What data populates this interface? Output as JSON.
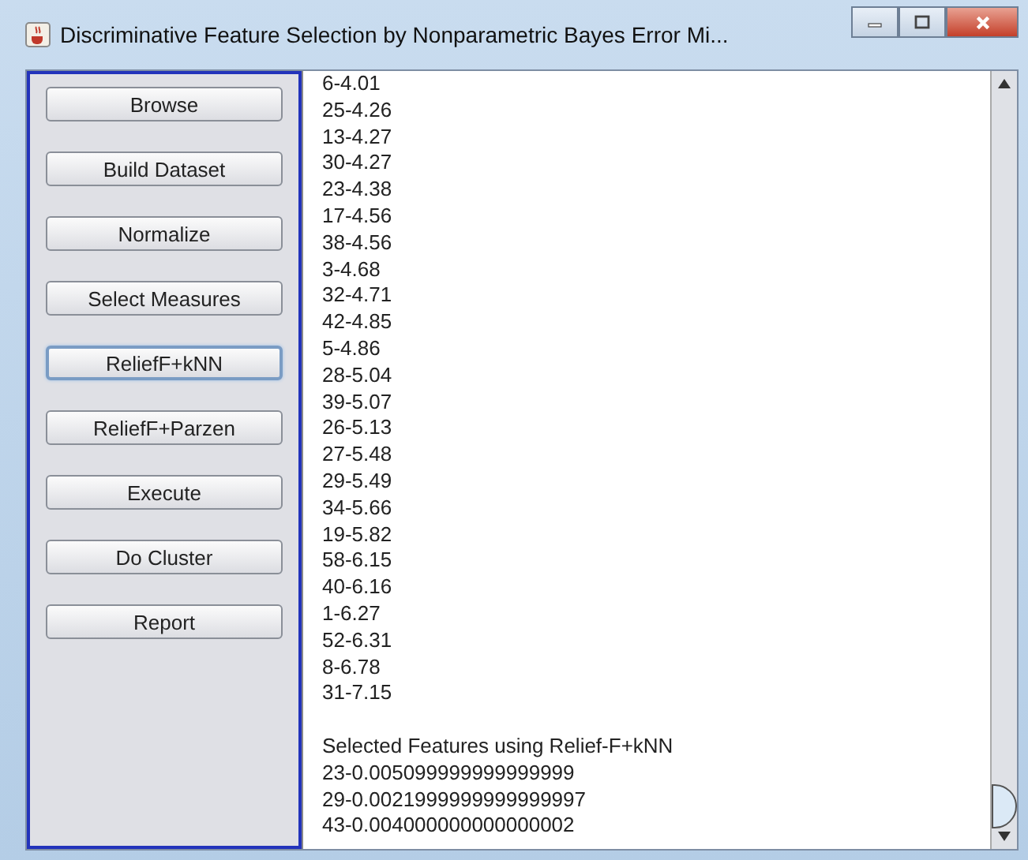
{
  "window": {
    "title": "Discriminative Feature Selection by Nonparametric Bayes Error Mi..."
  },
  "buttons": [
    {
      "label": "Browse",
      "focused": false
    },
    {
      "label": "Build Dataset",
      "focused": false
    },
    {
      "label": "Normalize",
      "focused": false
    },
    {
      "label": "Select Measures",
      "focused": false
    },
    {
      "label": "ReliefF+kNN",
      "focused": true
    },
    {
      "label": "ReliefF+Parzen",
      "focused": false
    },
    {
      "label": "Execute",
      "focused": false
    },
    {
      "label": "Do Cluster",
      "focused": false
    },
    {
      "label": "Report",
      "focused": false
    }
  ],
  "output_lines": [
    "6-4.01",
    "25-4.26",
    "13-4.27",
    "30-4.27",
    "23-4.38",
    "17-4.56",
    "38-4.56",
    "3-4.68",
    "32-4.71",
    "42-4.85",
    "5-4.86",
    "28-5.04",
    "39-5.07",
    "26-5.13",
    "27-5.48",
    "29-5.49",
    "34-5.66",
    "19-5.82",
    "58-6.15",
    "40-6.16",
    "1-6.27",
    "52-6.31",
    "8-6.78",
    "31-7.15"
  ],
  "selected_section": {
    "heading": "Selected Features using Relief-F+kNN",
    "lines": [
      "23-0.005099999999999999",
      "29-0.0021999999999999997",
      "43-0.004000000000000002"
    ]
  }
}
